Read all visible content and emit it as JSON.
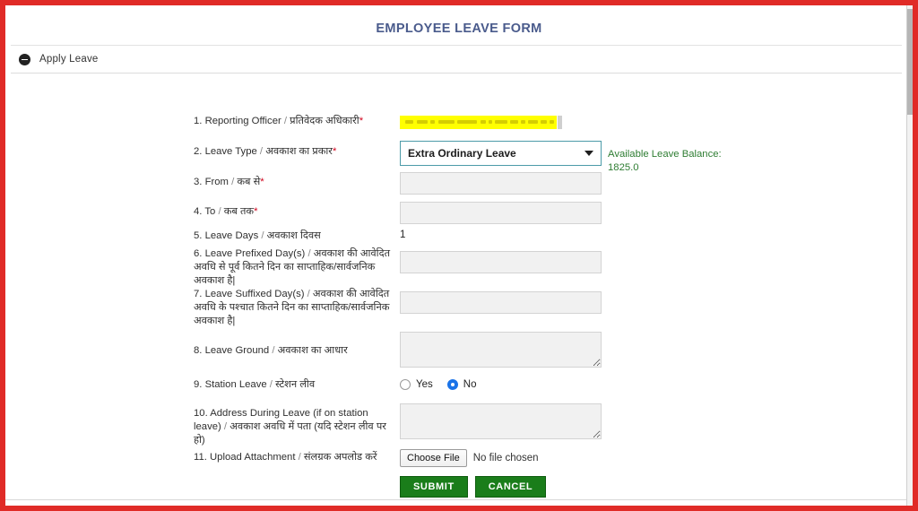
{
  "window": {
    "border_color": "#e02b27"
  },
  "header": {
    "title": "EMPLOYEE LEAVE FORM",
    "title_color": "#4a5b8c"
  },
  "panel": {
    "title": "Apply Leave",
    "collapse_icon": "minus-circle-icon"
  },
  "leave_balance": {
    "label": "Available Leave Balance:",
    "value": "1825.0",
    "color": "#2e7d32"
  },
  "fields": {
    "reporting_officer": {
      "number": "1.",
      "label_en": "Reporting Officer",
      "label_hi": "प्रतिवेदक अधिकारी",
      "required": true,
      "value": "",
      "redacted": true,
      "highlight_color": "#ffff00"
    },
    "leave_type": {
      "number": "2.",
      "label_en": "Leave Type",
      "label_hi": "अवकाश का प्रकार",
      "required": true,
      "selected": "Extra Ordinary Leave",
      "options": [
        "Extra Ordinary Leave"
      ],
      "border_color": "#4c9ba8"
    },
    "from": {
      "number": "3.",
      "label_en": "From",
      "label_hi": "कब से",
      "required": true,
      "value": "",
      "placeholder": ""
    },
    "to": {
      "number": "4.",
      "label_en": "To",
      "label_hi": "कब तक",
      "required": true,
      "value": "",
      "placeholder": ""
    },
    "leave_days": {
      "number": "5.",
      "label_en": "Leave Days",
      "label_hi": "अवकाश दिवस",
      "required": false,
      "value": "1"
    },
    "leave_prefixed_days": {
      "number": "6.",
      "label_en": "Leave Prefixed Day(s)",
      "label_hi": "अवकाश की आवेदित अवधि से पूर्व कितने दिन का साप्ताहिक/सार्वजनिक अवकाश है|",
      "required": false,
      "value": ""
    },
    "leave_suffixed_days": {
      "number": "7.",
      "label_en": "Leave Suffixed Day(s)",
      "label_hi": "अवकाश की आवेदित अवधि के पश्चात कितने दिन का साप्ताहिक/सार्वजनिक अवकाश है|",
      "required": false,
      "value": ""
    },
    "leave_ground": {
      "number": "8.",
      "label_en": "Leave Ground",
      "label_hi": "अवकाश का आधार",
      "required": false,
      "value": ""
    },
    "station_leave": {
      "number": "9.",
      "label_en": "Station Leave",
      "label_hi": "स्टेशन लीव",
      "required": false,
      "options": [
        "Yes",
        "No"
      ],
      "selected": "No"
    },
    "address_during_leave": {
      "number": "10.",
      "label_en": "Address During Leave (if on station leave)",
      "label_hi": "अवकाश अवधि में पता (यदि स्टेशन लीव पर हो)",
      "required": false,
      "value": ""
    },
    "upload_attachment": {
      "number": "11.",
      "label_en": "Upload Attachment",
      "label_hi": "संलग्रक अपलोड करें",
      "required": false,
      "button_label": "Choose File",
      "status": "No file chosen"
    }
  },
  "actions": {
    "submit_label": "SUBMIT",
    "cancel_label": "CANCEL",
    "button_color": "#1a7d1a"
  }
}
